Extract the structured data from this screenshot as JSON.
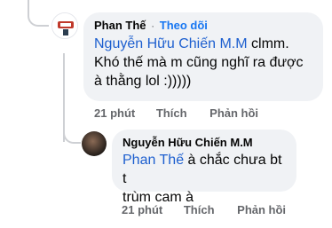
{
  "comment": {
    "author": "Phan Thế",
    "separator": "·",
    "follow_label": "Theo dõi",
    "mention": "Nguyễn Hữu Chiến M.M",
    "text_line1_rest": " clmm.",
    "text_line2": "Khó thế mà m cũng nghĩ ra được",
    "text_line3": "à thằng lol :)))))",
    "time": "21 phút",
    "like_label": "Thích",
    "reply_label": "Phản hồi"
  },
  "reply": {
    "author": "Nguyễn Hữu Chiến M.M",
    "mention": "Phan Thế",
    "text_line1_rest": " à chắc chưa bt t",
    "text_line2": "trùm cam à",
    "time": "21 phút",
    "like_label": "Thích",
    "reply_label": "Phản hồi"
  },
  "colors": {
    "accent": "#1877f2",
    "mention": "#1d5fcf",
    "bubble": "#f0f2f5",
    "secondary_text": "#65676b"
  }
}
